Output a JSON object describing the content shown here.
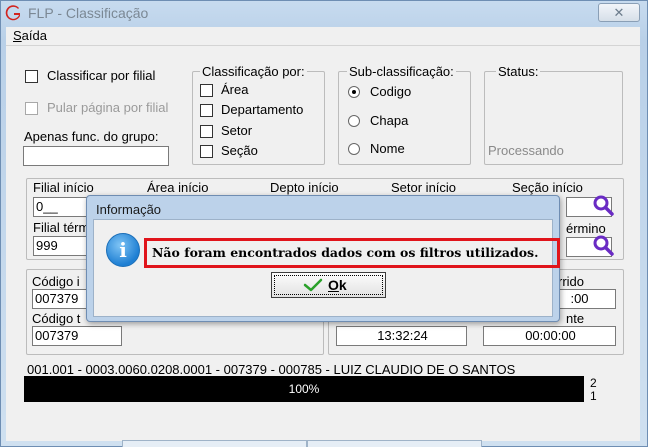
{
  "window": {
    "title": "FLP - Classificação",
    "close_glyph": "✕"
  },
  "menu": {
    "items": [
      "Saída"
    ]
  },
  "options": {
    "classificar_por_filial": "Classificar por filial",
    "pular_pagina_por_filial": "Pular página por filial",
    "apenas_func_grupo_label": "Apenas func. do grupo:",
    "apenas_func_grupo_value": ""
  },
  "classificacao": {
    "title": "Classificação  por:",
    "items": [
      "Área",
      "Departamento",
      "Setor",
      "Seção"
    ]
  },
  "sub_classificacao": {
    "title": "Sub-classificação:",
    "items": [
      "Codigo",
      "Chapa",
      "Nome"
    ],
    "selected": "Codigo"
  },
  "status": {
    "title": "Status:",
    "value": "Processando"
  },
  "ranges": {
    "filial_inicio_label": "Filial início",
    "filial_inicio_value": "0__",
    "area_inicio_label": "Área início",
    "depto_inicio_label": "Depto início",
    "setor_inicio_label": "Setor início",
    "secao_inicio_label": "Seção início",
    "filial_termino_label": "Filial térm",
    "filial_termino_value": "999",
    "termino_label": "érmino"
  },
  "codes": {
    "codigo_inicio_label": "Código i",
    "codigo_inicio_value": "007379",
    "codigo_termino_label": "Código t",
    "codigo_termino_value": "007379"
  },
  "times": {
    "decorrido_label": "rrido",
    "decorrido_value": ":00",
    "restante_label": "nte",
    "hora_value": "13:32:24",
    "restante_value": "00:00:00"
  },
  "progress": {
    "status_line": "001.001 - 0003.0060.0208.0001 - 007379 - 000785 - LUIZ CLAUDIO DE O SANTOS",
    "percent_text": "100%",
    "percent": 100,
    "counter_a": "2",
    "counter_b": "1"
  },
  "dialog": {
    "title": "Informação",
    "message": "Não foram encontrados dados com os filtros utilizados.",
    "ok_label": "Ok",
    "icon_glyph": "i"
  },
  "colors": {
    "highlight_box": "#e0141b",
    "progress_bar": "#000000",
    "zoom_icon": "#6a2bc4"
  }
}
